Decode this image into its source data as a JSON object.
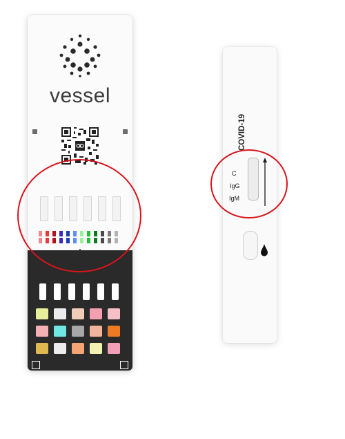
{
  "vessel_card": {
    "brand": "vessel",
    "reference_colors": [
      "#f08a8a",
      "#e73939",
      "#b2101b",
      "#3a2ac2",
      "#1b3eb0",
      "#5f8ff0",
      "#9aef9a",
      "#20c130",
      "#0f7a1d",
      "#4a4a4a",
      "#7e7e7e",
      "#b4b4b4"
    ],
    "color_grid": [
      [
        "#e8ef9a",
        "#ececec",
        "#f0cdb8",
        "#f39fb0",
        "#f5c1c6"
      ],
      [
        "#f4b0b4",
        "#6fe8e4",
        "#a7a7a7",
        "#f2b39a",
        "#f07a22"
      ],
      [
        "#e0b850",
        "#ececec",
        "#f6a474",
        "#f1f1b0",
        "#f2a0b8"
      ]
    ],
    "icons": [
      "droplet-outline-icon",
      "qr-code-icon"
    ]
  },
  "covid_cassette": {
    "title": "COVID-19",
    "line_labels": [
      "C",
      "IgG",
      "IgM"
    ],
    "icons": [
      "arrow-up-icon",
      "drop-filled-icon"
    ]
  },
  "accent_colors": {
    "highlight": "#d8141c",
    "panel": "#2a2a2a"
  }
}
